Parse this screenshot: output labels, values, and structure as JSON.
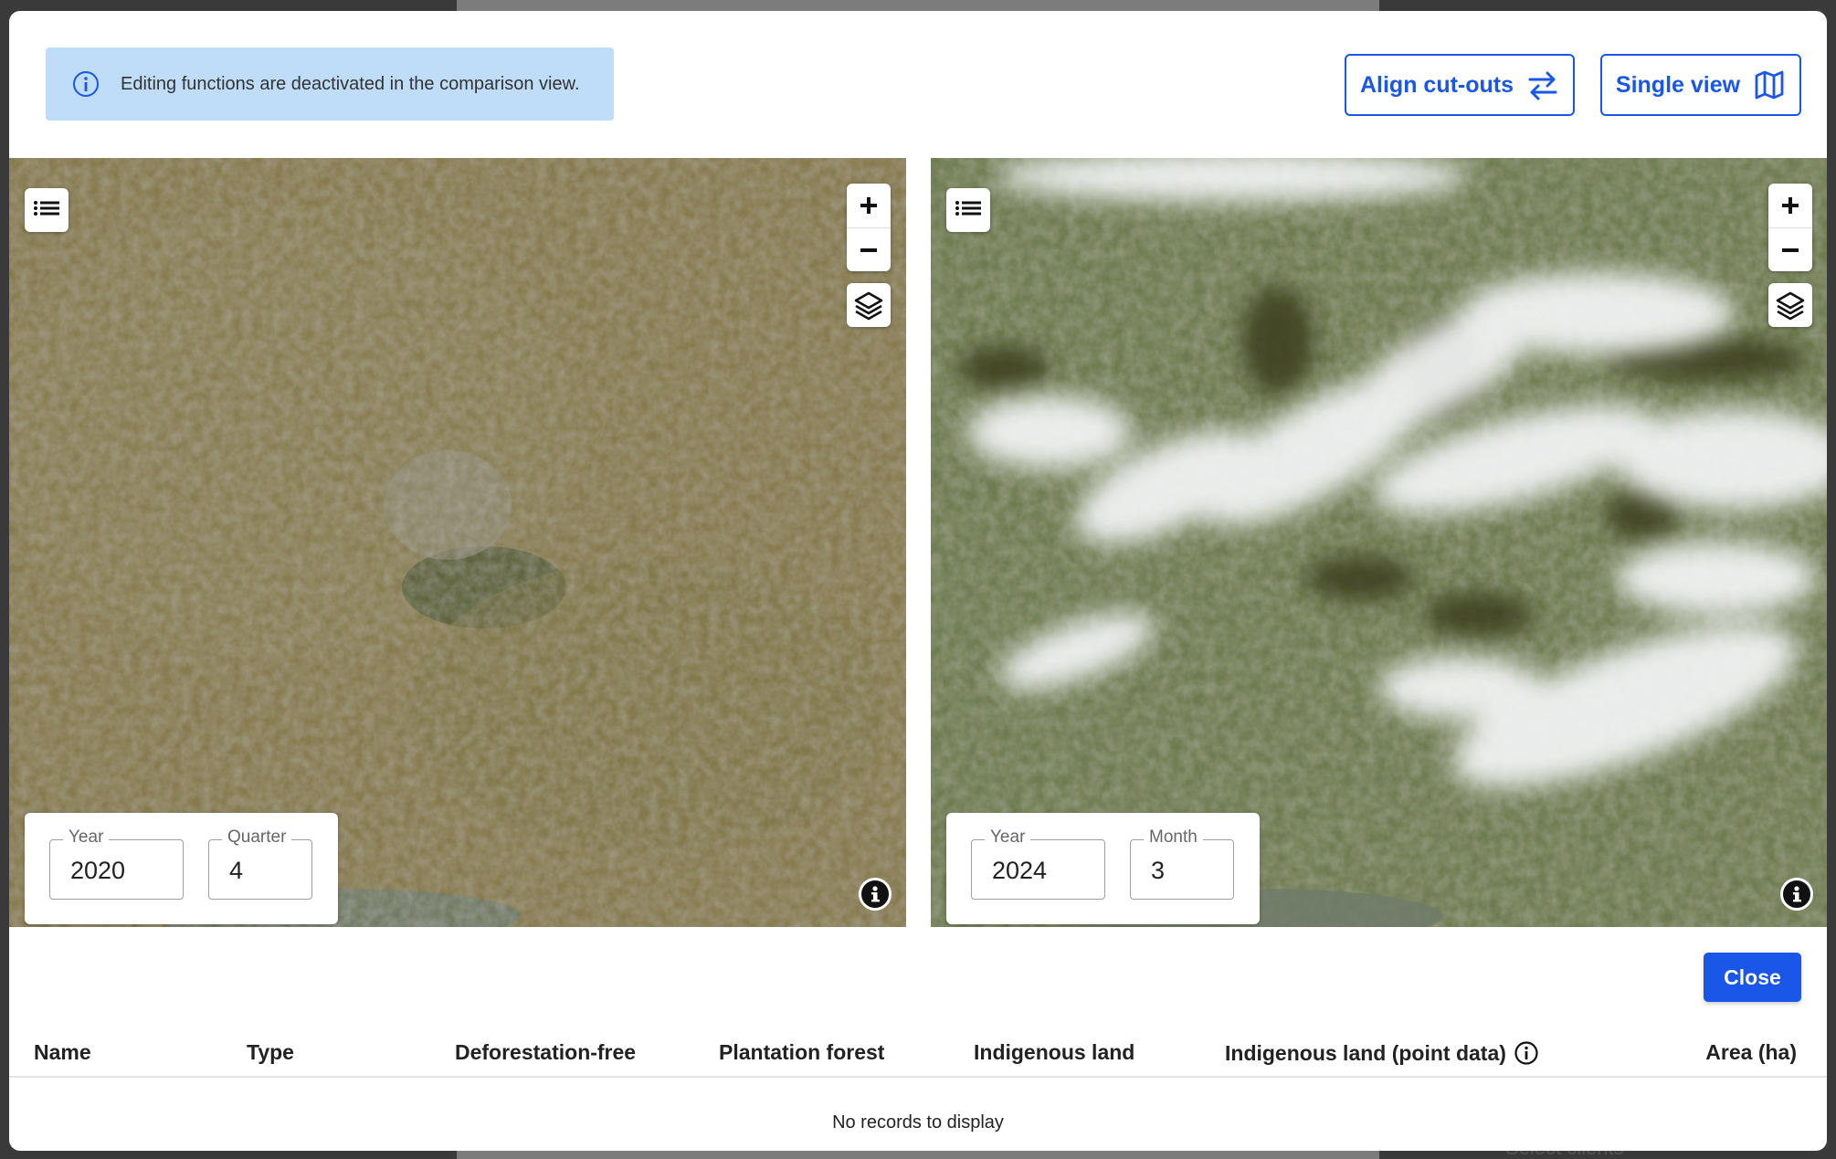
{
  "background": {
    "peek_text": "Select clients"
  },
  "banner": {
    "text": "Editing functions are deactivated in the comparison view.",
    "icon": "info-circle-icon"
  },
  "toolbar": {
    "align_label": "Align cut-outs",
    "single_view_label": "Single view",
    "accent_color": "#1a56e8"
  },
  "maps": {
    "left": {
      "year_label": "Year",
      "year_value": "2020",
      "period_label": "Quarter",
      "period_value": "4"
    },
    "right": {
      "year_label": "Year",
      "year_value": "2024",
      "period_label": "Month",
      "period_value": "3"
    }
  },
  "actions": {
    "close_label": "Close"
  },
  "table": {
    "columns": [
      "Name",
      "Type",
      "Deforestation-free",
      "Plantation forest",
      "Indigenous land",
      "Indigenous land (point data)",
      "Area (ha)"
    ],
    "empty_message": "No records to display"
  }
}
